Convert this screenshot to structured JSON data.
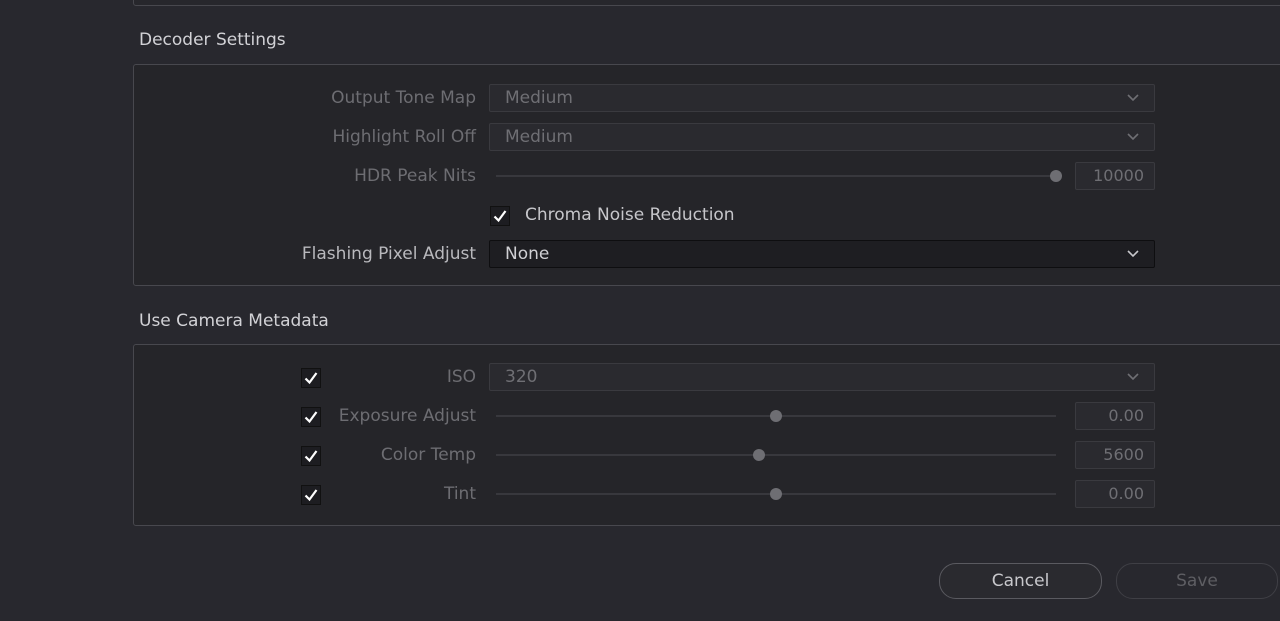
{
  "decoder": {
    "title": "Decoder Settings",
    "output_tone_map": {
      "label": "Output Tone Map",
      "value": "Medium"
    },
    "highlight_roll_off": {
      "label": "Highlight Roll Off",
      "value": "Medium"
    },
    "hdr_peak_nits": {
      "label": "HDR Peak Nits",
      "value": "10000",
      "level": 1.0
    },
    "chroma_noise_reduction": {
      "label": "Chroma Noise Reduction",
      "checked": true
    },
    "flashing_pixel_adjust": {
      "label": "Flashing Pixel Adjust",
      "value": "None"
    }
  },
  "camera_metadata": {
    "title": "Use Camera Metadata",
    "iso": {
      "label": "ISO",
      "value": "320",
      "checked": true
    },
    "exposure_adjust": {
      "label": "Exposure Adjust",
      "value": "0.00",
      "level": 0.5,
      "checked": true
    },
    "color_temp": {
      "label": "Color Temp",
      "value": "5600",
      "level": 0.47,
      "checked": true
    },
    "tint": {
      "label": "Tint",
      "value": "0.00",
      "level": 0.5,
      "checked": true
    }
  },
  "buttons": {
    "cancel": "Cancel",
    "save": "Save"
  },
  "colors": {
    "background": "#28282e",
    "panel_border": "#48484e",
    "text": "#c8c8cc",
    "disabled_text": "#6d6d72"
  }
}
